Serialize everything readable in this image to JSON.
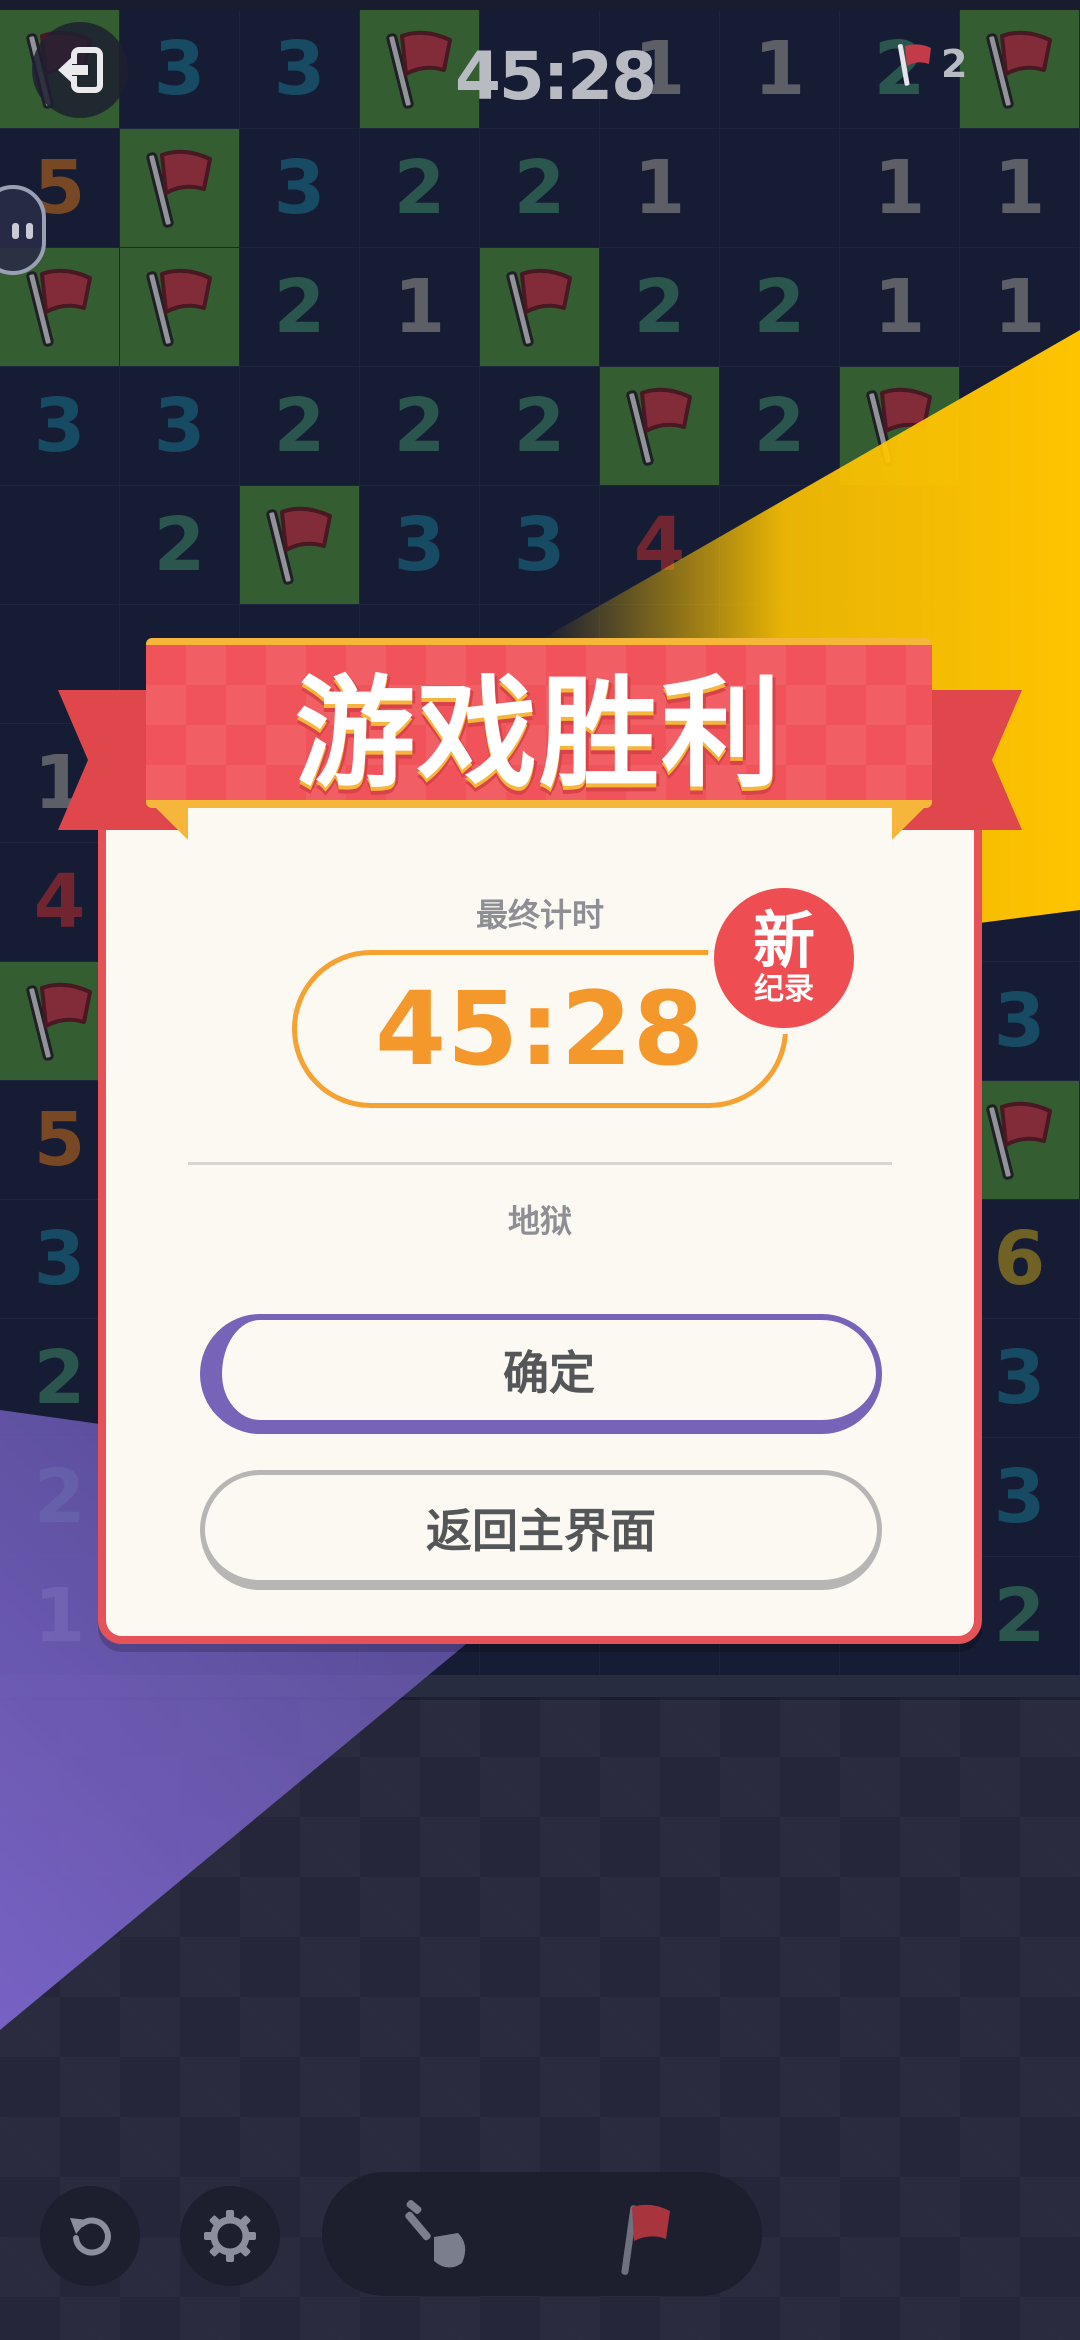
{
  "hud": {
    "timer": "45:28",
    "flags_remaining": "2"
  },
  "board": {
    "columns": 9,
    "rows": [
      [
        "F",
        "3",
        "3",
        "F",
        "",
        "1",
        "1",
        "2",
        "F"
      ],
      [
        "5",
        "F",
        "3",
        "2",
        "2",
        "1",
        "",
        "1",
        "1"
      ],
      [
        "F",
        "F",
        "2",
        "1",
        "F",
        "2",
        "2",
        "1",
        "1"
      ],
      [
        "3",
        "3",
        "2",
        "2",
        "2",
        "F",
        "2",
        "F",
        ""
      ],
      [
        "",
        "2",
        "F",
        "3",
        "3",
        "4",
        "",
        "",
        ""
      ],
      [
        "",
        "",
        "",
        "",
        "",
        "",
        "",
        "",
        ""
      ],
      [
        "1",
        "",
        "",
        "",
        "",
        "",
        "",
        "",
        ""
      ],
      [
        "4",
        "",
        "",
        "",
        "",
        "",
        "",
        "",
        ""
      ],
      [
        "F",
        "",
        "",
        "",
        "",
        "",
        "",
        "",
        "3"
      ],
      [
        "5",
        "",
        "",
        "",
        "",
        "",
        "",
        "",
        "F"
      ],
      [
        "3",
        "",
        "",
        "",
        "",
        "",
        "",
        "",
        "6"
      ],
      [
        "2",
        "",
        "",
        "",
        "",
        "",
        "",
        "",
        "3"
      ],
      [
        "2",
        "",
        "",
        "",
        "",
        "",
        "",
        "",
        "3"
      ],
      [
        "1",
        "",
        "",
        "",
        "",
        "",
        "",
        "",
        "2"
      ]
    ]
  },
  "dialog": {
    "title": "游戏胜利",
    "final_time_label": "最终计时",
    "final_time": "45:28",
    "record_badge_big": "新",
    "record_badge_small": "纪录",
    "difficulty": "地狱",
    "confirm_label": "确定",
    "home_label": "返回主界面"
  },
  "colors": {
    "ribbon": "#f0545a",
    "accent_orange": "#f4982c",
    "confirm_border": "#7763b8",
    "flag_cell": "#4c8a3e",
    "beam_yellow": "#ffc400",
    "beam_purple": "#7762c4"
  },
  "toolbar": {
    "icons": [
      "undo-icon",
      "settings-icon",
      "shovel-icon",
      "flag-icon"
    ]
  }
}
